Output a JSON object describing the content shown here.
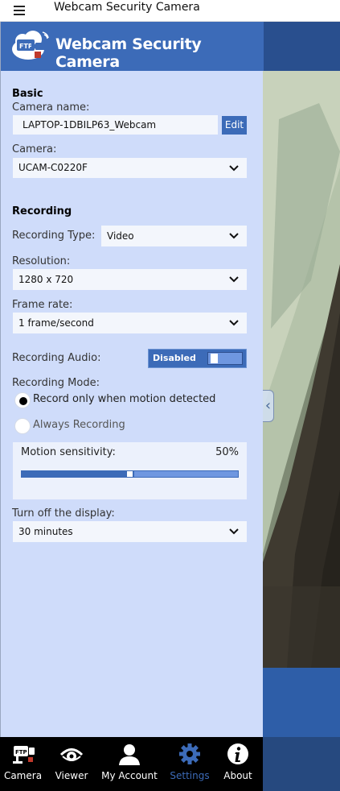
{
  "window": {
    "title": "Webcam Security Camera"
  },
  "header": {
    "logo_title": "Webcam Security Camera",
    "logo_icon": "ftp-camera-logo-icon"
  },
  "basic": {
    "section_title": "Basic",
    "camera_name_label": "Camera name:",
    "camera_name_value": "LAPTOP-1DBILP63_Webcam",
    "edit_label": "Edit",
    "camera_label": "Camera:",
    "camera_value": "UCAM-C0220F"
  },
  "recording": {
    "section_title": "Recording",
    "type_label": "Recording Type:",
    "type_value": "Video",
    "resolution_label": "Resolution:",
    "resolution_value": "1280 x 720",
    "frame_rate_label": "Frame rate:",
    "frame_rate_value": "1 frame/second",
    "audio_label": "Recording Audio:",
    "audio_toggle_label": "Disabled",
    "audio_enabled": false,
    "mode_label": "Recording Mode:",
    "mode_options": [
      {
        "label": "Record only when motion detected",
        "selected": true
      },
      {
        "label": "Always Recording",
        "selected": false
      }
    ],
    "sensitivity_label": "Motion sensitivity:",
    "sensitivity_value": "50%",
    "sensitivity_fraction": 0.5
  },
  "display": {
    "label": "Turn off the display:",
    "value": "30 minutes"
  },
  "nav": [
    {
      "label": "Camera",
      "icon": "ftp-camera-icon",
      "active": false
    },
    {
      "label": "Viewer",
      "icon": "eye-icon",
      "active": false
    },
    {
      "label": "My Account",
      "icon": "user-icon",
      "active": false
    },
    {
      "label": "Settings",
      "icon": "gear-icon",
      "active": true
    },
    {
      "label": "About",
      "icon": "info-icon",
      "active": false
    }
  ],
  "colors": {
    "accent": "#3c6bb8",
    "panel_bg": "#cfdcfa",
    "nav_bg": "#000000",
    "slider_rest": "#6f97e0"
  }
}
